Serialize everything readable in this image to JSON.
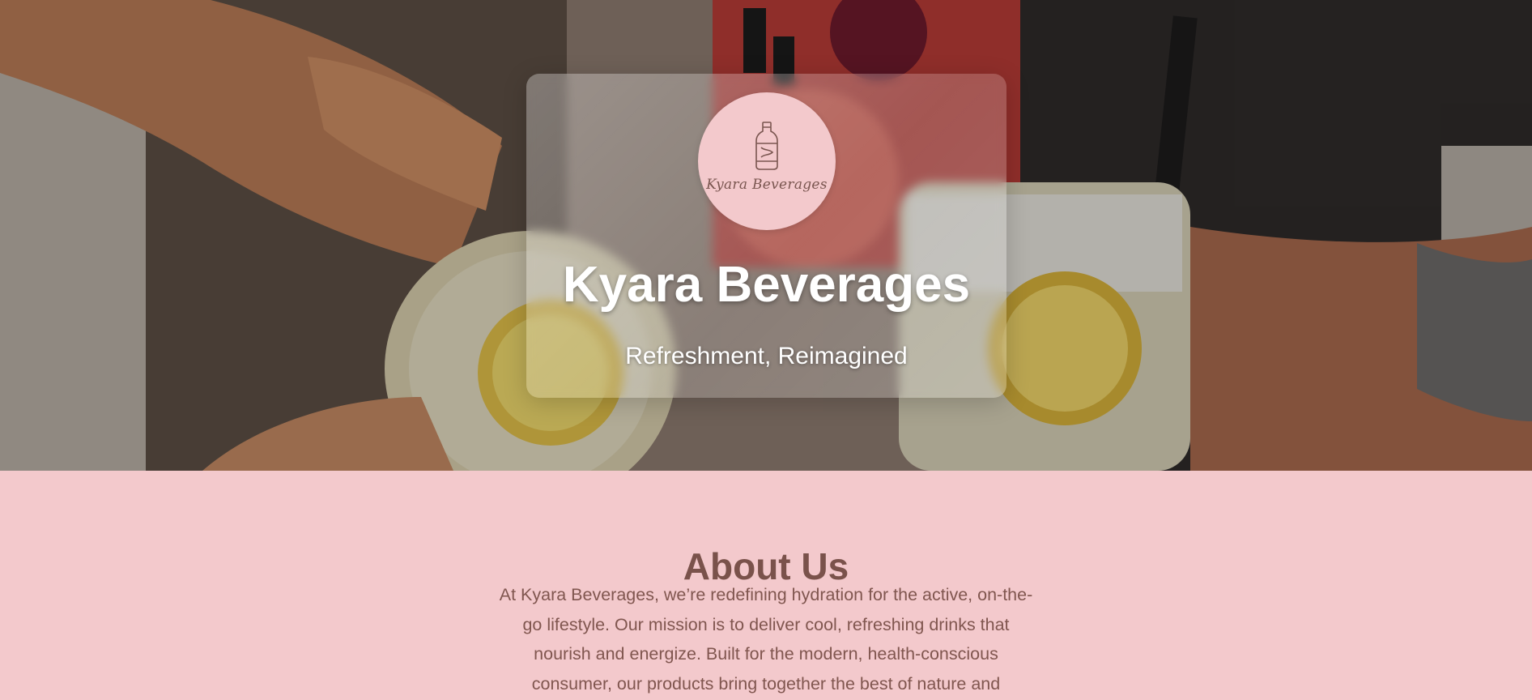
{
  "hero": {
    "logo": {
      "icon": "bottle-icon",
      "text": "Kyara Beverages"
    },
    "title": "Kyara Beverages",
    "tagline": "Refreshment, Reimagined"
  },
  "about": {
    "title": "About Us",
    "body": "At Kyara Beverages, we’re redefining hydration for the active, on-the-go lifestyle. Our mission is to deliver cool, refreshing drinks that nourish and energize. Built for the modern, health-conscious consumer, our products bring together the best of nature and"
  },
  "colors": {
    "about_background": "#f3c9cc",
    "about_heading": "#7a524b",
    "logo_circle": "#f3c9cc"
  }
}
